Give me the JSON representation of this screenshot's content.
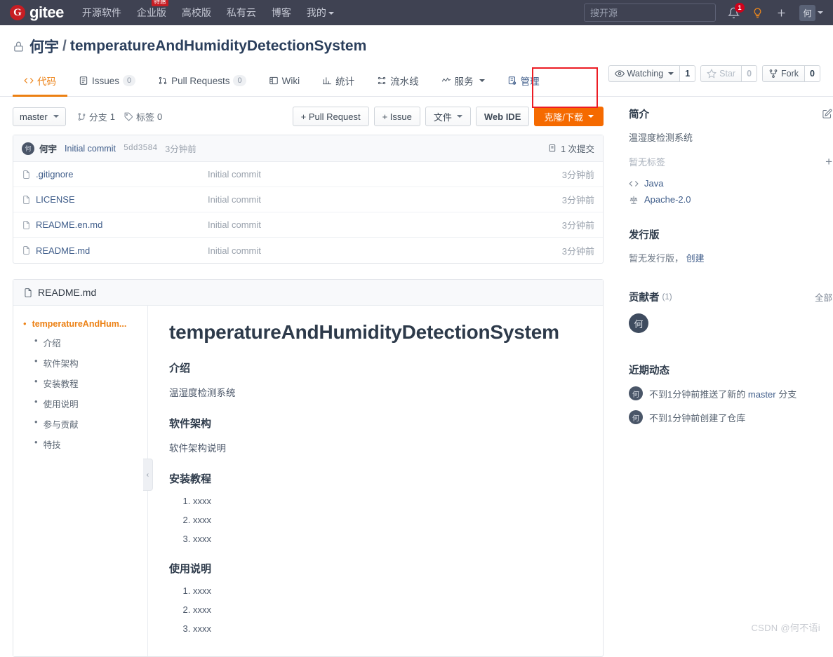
{
  "topnav": {
    "brand": "gitee",
    "brand_mark": "G",
    "links": [
      {
        "label": "开源软件"
      },
      {
        "label": "企业版",
        "badge": "特惠"
      },
      {
        "label": "高校版"
      },
      {
        "label": "私有云"
      },
      {
        "label": "博客"
      },
      {
        "label": "我的",
        "caret": true
      }
    ],
    "search_placeholder": "搜开源",
    "search_value": "",
    "notification_count": "1",
    "user_initial": "何"
  },
  "repo": {
    "owner": "何宇",
    "separator": "/",
    "name": "temperatureAndHumidityDetectionSystem",
    "visibility": "private",
    "actions": {
      "watch_label": "Watching",
      "watch_count": "1",
      "star_label": "Star",
      "star_count": "0",
      "fork_label": "Fork",
      "fork_count": "0"
    }
  },
  "tabs": [
    {
      "label": "代码",
      "icon": "code-icon",
      "active": true
    },
    {
      "label": "Issues",
      "icon": "issue-icon",
      "count": "0"
    },
    {
      "label": "Pull Requests",
      "icon": "pull-request-icon",
      "count": "0"
    },
    {
      "label": "Wiki",
      "icon": "wiki-icon"
    },
    {
      "label": "统计",
      "icon": "chart-icon"
    },
    {
      "label": "流水线",
      "icon": "pipeline-icon"
    },
    {
      "label": "服务",
      "icon": "service-icon",
      "caret": true
    },
    {
      "label": "管理",
      "icon": "manage-icon",
      "highlighted": true
    }
  ],
  "toolbar": {
    "branch": "master",
    "branches_label": "分支",
    "branches_count": "1",
    "tags_label": "标签",
    "tags_count": "0",
    "pull_request": "+ Pull Request",
    "issue": "+ Issue",
    "files": "文件",
    "web_ide": "Web IDE",
    "clone": "克隆/下载"
  },
  "commit_bar": {
    "author": "何宇",
    "author_initial": "何",
    "message": "Initial commit",
    "sha": "5dd3584",
    "time": "3分钟前",
    "commits_label": "1 次提交"
  },
  "files": [
    {
      "name": ".gitignore",
      "commit": "Initial commit",
      "time": "3分钟前"
    },
    {
      "name": "LICENSE",
      "commit": "Initial commit",
      "time": "3分钟前"
    },
    {
      "name": "README.en.md",
      "commit": "Initial commit",
      "time": "3分钟前"
    },
    {
      "name": "README.md",
      "commit": "Initial commit",
      "time": "3分钟前"
    }
  ],
  "readme": {
    "title": "README.md",
    "toc": [
      {
        "label": "temperatureAndHum...",
        "root": true
      },
      {
        "label": "介绍",
        "root": false
      },
      {
        "label": "软件架构",
        "root": false
      },
      {
        "label": "安装教程",
        "root": false
      },
      {
        "label": "使用说明",
        "root": false
      },
      {
        "label": "参与贡献",
        "root": false
      },
      {
        "label": "特技",
        "root": false
      }
    ],
    "h1": "temperatureAndHumidityDetectionSystem",
    "sections": [
      {
        "heading": "介绍",
        "paragraph": "温湿度检测系统",
        "list": []
      },
      {
        "heading": "软件架构",
        "paragraph": "软件架构说明",
        "list": []
      },
      {
        "heading": "安装教程",
        "paragraph": "",
        "list": [
          "xxxx",
          "xxxx",
          "xxxx"
        ]
      },
      {
        "heading": "使用说明",
        "paragraph": "",
        "list": [
          "xxxx",
          "xxxx",
          "xxxx"
        ]
      }
    ]
  },
  "sidebar": {
    "intro_heading": "简介",
    "intro_edit": "edit-icon",
    "intro_text": "温湿度检测系统",
    "tags_empty": "暂无标签",
    "tag_add": "+",
    "language": "Java",
    "license": "Apache-2.0",
    "release_heading": "发行版",
    "release_empty": "暂无发行版，",
    "release_create": "创建",
    "contributors_heading": "贡献者",
    "contributors_count": "(1)",
    "contributors_all": "全部",
    "contributor_initial": "何",
    "activity_heading": "近期动态",
    "activities": [
      {
        "initial": "何",
        "prefix": "不到1分钟前推送了新的",
        "branch": "master",
        "suffix": "分支"
      },
      {
        "initial": "何",
        "prefix": "不到1分钟前创建了仓库",
        "branch": "",
        "suffix": ""
      }
    ]
  },
  "watermark": "CSDN @何不语i"
}
